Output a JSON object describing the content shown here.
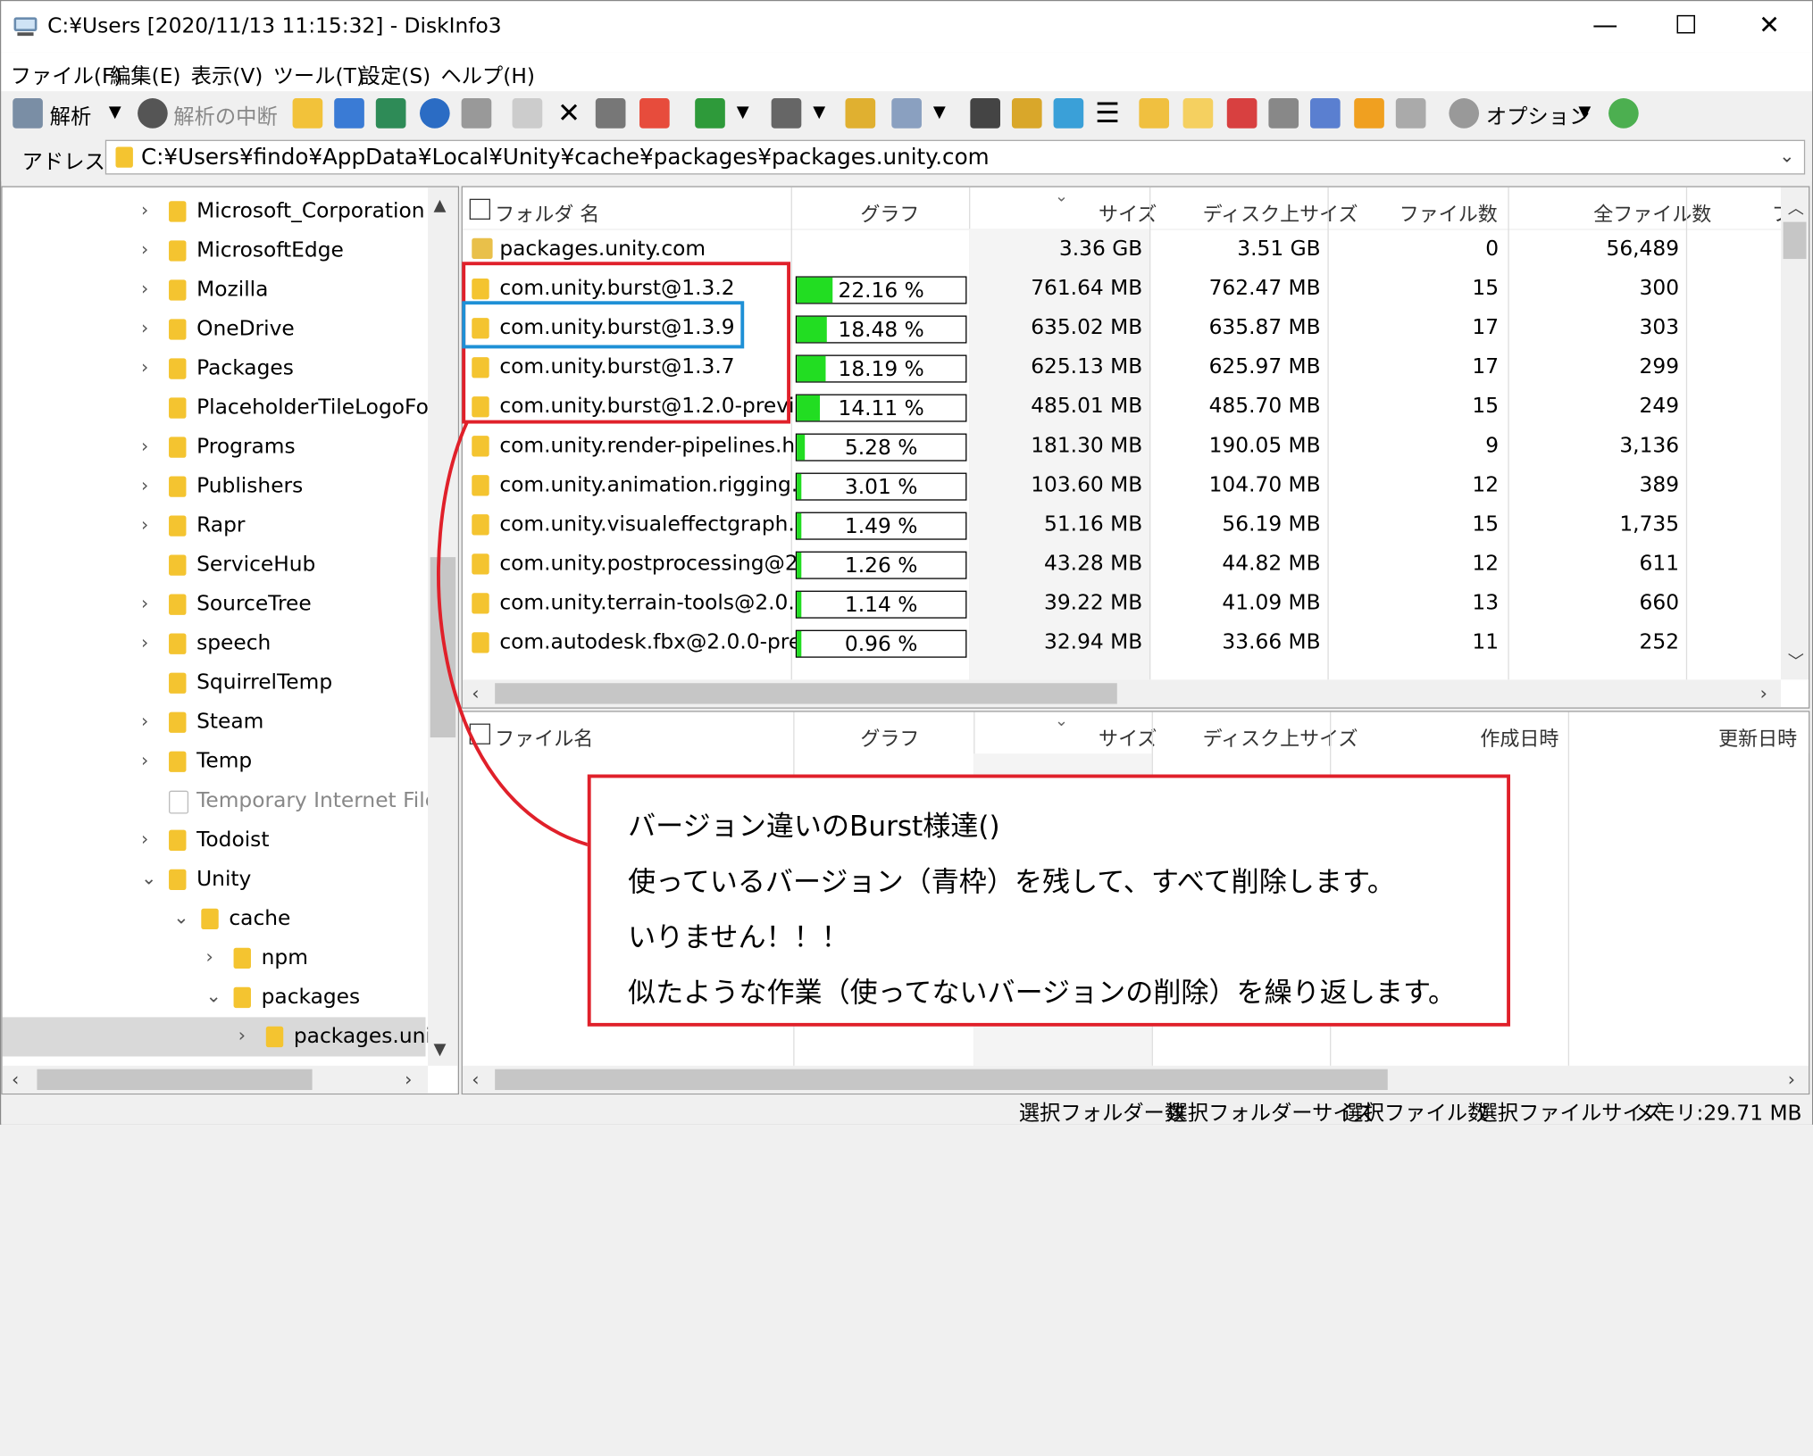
{
  "window": {
    "title": "C:¥Users [2020/11/13 11:15:32] - DiskInfo3",
    "min": "—",
    "max": "☐",
    "close": "✕"
  },
  "menu": [
    "ファイル(F)",
    "編集(E)",
    "表示(V)",
    "ツール(T)",
    "設定(S)",
    "ヘルプ(H)"
  ],
  "toolbar": {
    "analyze": "解析",
    "stop": "解析の中断",
    "options": "オプション"
  },
  "address": {
    "label": "アドレス",
    "path": "C:¥Users¥findo¥AppData¥Local¥Unity¥cache¥packages¥packages.unity.com"
  },
  "tree": [
    {
      "label": "Microsoft_Corporation",
      "expandable": true
    },
    {
      "label": "MicrosoftEdge",
      "expandable": true
    },
    {
      "label": "Mozilla",
      "expandable": true
    },
    {
      "label": "OneDrive",
      "expandable": true
    },
    {
      "label": "Packages",
      "expandable": true
    },
    {
      "label": "PlaceholderTileLogoFold",
      "expandable": false
    },
    {
      "label": "Programs",
      "expandable": true
    },
    {
      "label": "Publishers",
      "expandable": true
    },
    {
      "label": "Rapr",
      "expandable": true
    },
    {
      "label": "ServiceHub",
      "expandable": false
    },
    {
      "label": "SourceTree",
      "expandable": true
    },
    {
      "label": "speech",
      "expandable": true
    },
    {
      "label": "SquirrelTemp",
      "expandable": false
    },
    {
      "label": "Steam",
      "expandable": true
    },
    {
      "label": "Temp",
      "expandable": true
    },
    {
      "label": "Temporary Internet Files",
      "expandable": false
    },
    {
      "label": "Todoist",
      "expandable": true
    },
    {
      "label": "Unity",
      "expandable": true
    },
    {
      "label": "cache",
      "expandable": true
    },
    {
      "label": "npm",
      "expandable": true
    },
    {
      "label": "packages",
      "expandable": true
    },
    {
      "label": "packages.unity",
      "expandable": true
    }
  ],
  "folder_table": {
    "headers": [
      "フォルダ 名",
      "グラフ",
      "サイズ",
      "ディスク上サイズ",
      "ファイル数",
      "全ファイル数",
      "フ"
    ],
    "root": {
      "name": "packages.unity.com",
      "size": "3.36 GB",
      "disk": "3.51 GB",
      "files": "0",
      "all": "56,489"
    },
    "rows": [
      {
        "name": "com.unity.burst@1.3.2",
        "pct": 22.16,
        "pct_label": "22.16 %",
        "size": "761.64 MB",
        "disk": "762.47 MB",
        "files": "15",
        "all": "300"
      },
      {
        "name": "com.unity.burst@1.3.9",
        "pct": 18.48,
        "pct_label": "18.48 %",
        "size": "635.02 MB",
        "disk": "635.87 MB",
        "files": "17",
        "all": "303"
      },
      {
        "name": "com.unity.burst@1.3.7",
        "pct": 18.19,
        "pct_label": "18.19 %",
        "size": "625.13 MB",
        "disk": "625.97 MB",
        "files": "17",
        "all": "299"
      },
      {
        "name": "com.unity.burst@1.2.0-previ...",
        "pct": 14.11,
        "pct_label": "14.11 %",
        "size": "485.01 MB",
        "disk": "485.70 MB",
        "files": "15",
        "all": "249"
      },
      {
        "name": "com.unity.render-pipelines.h...",
        "pct": 5.28,
        "pct_label": "5.28 %",
        "size": "181.30 MB",
        "disk": "190.05 MB",
        "files": "9",
        "all": "3,136"
      },
      {
        "name": "com.unity.animation.rigging...",
        "pct": 3.01,
        "pct_label": "3.01 %",
        "size": "103.60 MB",
        "disk": "104.70 MB",
        "files": "12",
        "all": "389"
      },
      {
        "name": "com.unity.visualeffectgraph...",
        "pct": 1.49,
        "pct_label": "1.49 %",
        "size": "51.16 MB",
        "disk": "56.19 MB",
        "files": "15",
        "all": "1,735"
      },
      {
        "name": "com.unity.postprocessing@2...",
        "pct": 1.26,
        "pct_label": "1.26 %",
        "size": "43.28 MB",
        "disk": "44.82 MB",
        "files": "12",
        "all": "611"
      },
      {
        "name": "com.unity.terrain-tools@2.0....",
        "pct": 1.14,
        "pct_label": "1.14 %",
        "size": "39.22 MB",
        "disk": "41.09 MB",
        "files": "13",
        "all": "660"
      },
      {
        "name": "com.autodesk.fbx@2.0.0-pre...",
        "pct": 0.96,
        "pct_label": "0.96 %",
        "size": "32.94 MB",
        "disk": "33.66 MB",
        "files": "11",
        "all": "252"
      }
    ]
  },
  "file_table": {
    "headers": [
      "ファイル名",
      "グラフ",
      "サイズ",
      "ディスク上サイズ",
      "作成日時",
      "更新日時"
    ]
  },
  "annotation": {
    "lines": [
      "バージョン違いのBurst様達()",
      "使っているバージョン（青枠）を残して、すべて削除します。",
      "いりません！！！",
      "似たような作業（使ってないバージョンの削除）を繰り返します。"
    ],
    "box_color": "#e0202a",
    "highlight_color": "#1e90d6"
  },
  "status": [
    "選択フォルダー数",
    "選択フォルダーサイズ",
    "選択ファイル数",
    "選択ファイルサイズ",
    "メモリ:29.71 MB"
  ]
}
